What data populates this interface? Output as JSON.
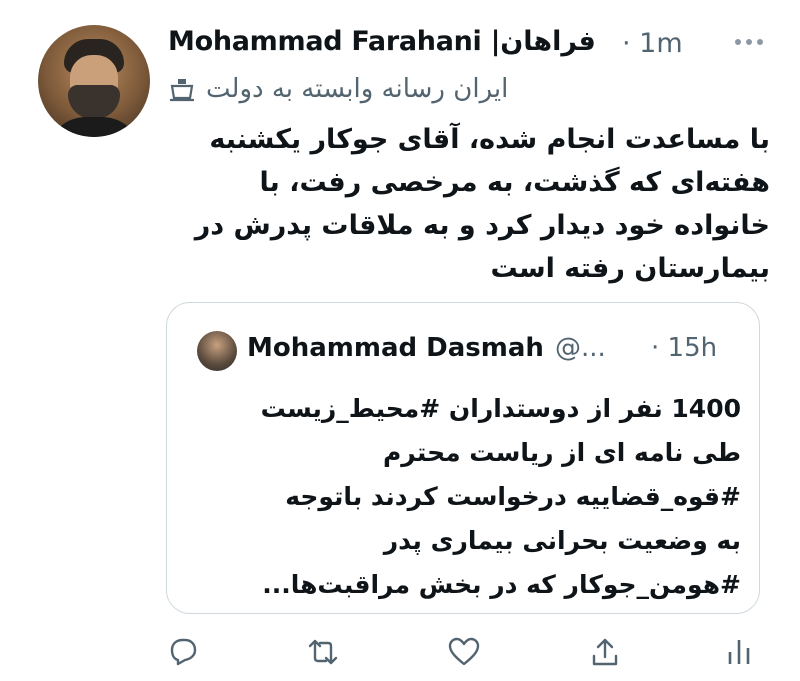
{
  "tweet": {
    "author_name": "Mohammad Farahani",
    "author_name_fa": "فراهان",
    "separator": "|",
    "timestamp": "· 1m",
    "affiliation": "ایران رسانه وابسته به دولت",
    "text_lines": [
      "با مساعدت انجام شده، آقای جوکار یکشنبه",
      "هفته‌ای که گذشت، به مرخصی رفت، با",
      "خانواده خود دیدار کرد و به ملاقات پدرش در",
      "بیمارستان رفته است"
    ]
  },
  "quoted": {
    "name": "Mohammad Dasmah",
    "handle": "@...",
    "timestamp": "· 15h",
    "text_lines": [
      "1400 نفر از دوستداران #محیط_زیست",
      "طی نامه ای از ریاست محترم",
      "#قوه_قضاییه درخواست کردند باتوجه",
      "به وضعیت بحرانی بیماری پدر",
      "#هومن_جوکار که در بخش مراقبت‌ها..."
    ]
  },
  "actions": [
    "reply-icon",
    "retweet-icon",
    "like-icon",
    "share-icon",
    "analytics-icon"
  ],
  "colors": {
    "text": "#0f1419",
    "secondary": "#536471",
    "border": "#cfd9de"
  }
}
